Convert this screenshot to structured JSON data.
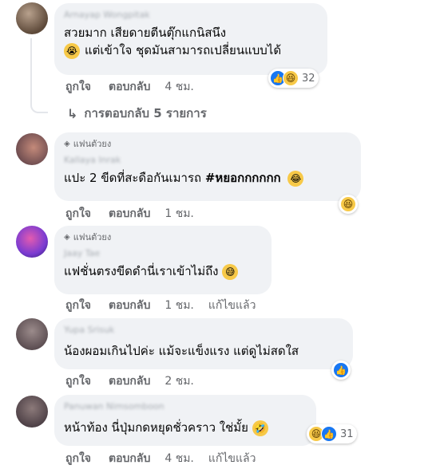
{
  "comments": [
    {
      "author": "Arnayap Wongpitak",
      "lines": [
        "สวยมาก เสียดายตีนตุ๊กแกนิสนึง",
        "แต่เข้าใจ ชุดมันสามารถเปลี่ยนแบบได้"
      ],
      "leading_emoji": "😭",
      "actions": {
        "like": "ถูกใจ",
        "reply": "ตอบกลับ",
        "time": "4 ชม."
      },
      "reactions": {
        "count": "32"
      },
      "replies_label": "การตอบกลับ 5 รายการ"
    },
    {
      "badge": "แฟนตัวยง",
      "author": "Kallaya Inrak",
      "text_plain": "แปะ 2 ขีดที่สะดือกันเมารถ ",
      "text_bold": "#หยอกกกกกก",
      "trailing_emoji": "😂",
      "actions": {
        "like": "ถูกใจ",
        "reply": "ตอบกลับ",
        "time": "1 ชม."
      }
    },
    {
      "badge": "แฟนตัวยง",
      "author": "Jaay Tae",
      "text": "แฟชั่นตรงขีดดำนี่เราเข้าไม่ถึง",
      "trailing_emoji": "😅",
      "actions": {
        "like": "ถูกใจ",
        "reply": "ตอบกลับ",
        "time": "1 ชม.",
        "edited": "แก้ไขแล้ว"
      }
    },
    {
      "author": "Yupa Srisuk",
      "text": "น้องผอมเกินไปค่ะ แม้จะแข็งแรง แต่ดูไม่สดใส",
      "actions": {
        "like": "ถูกใจ",
        "reply": "ตอบกลับ",
        "time": "2 ชม."
      }
    },
    {
      "author": "Panuwan Nimsomboon",
      "text": "หน้าท้อง นี่ปุ่มกดหยุดชั่วคราว ใช่มั้ย",
      "trailing_emoji": "🤣",
      "actions": {
        "like": "ถูกใจ",
        "reply": "ตอบกลับ",
        "time": "4 ชม.",
        "edited": "แก้ไขแล้ว"
      },
      "reactions": {
        "count": "31"
      }
    }
  ],
  "icons": {
    "like": "like-icon",
    "haha": "haha-icon",
    "reply_arrow": "reply-arrow-icon",
    "diamond": "diamond-icon"
  },
  "colors": {
    "bubble": "#f0f2f5",
    "secondary_text": "#65676b",
    "like_blue": "#1877f2"
  }
}
